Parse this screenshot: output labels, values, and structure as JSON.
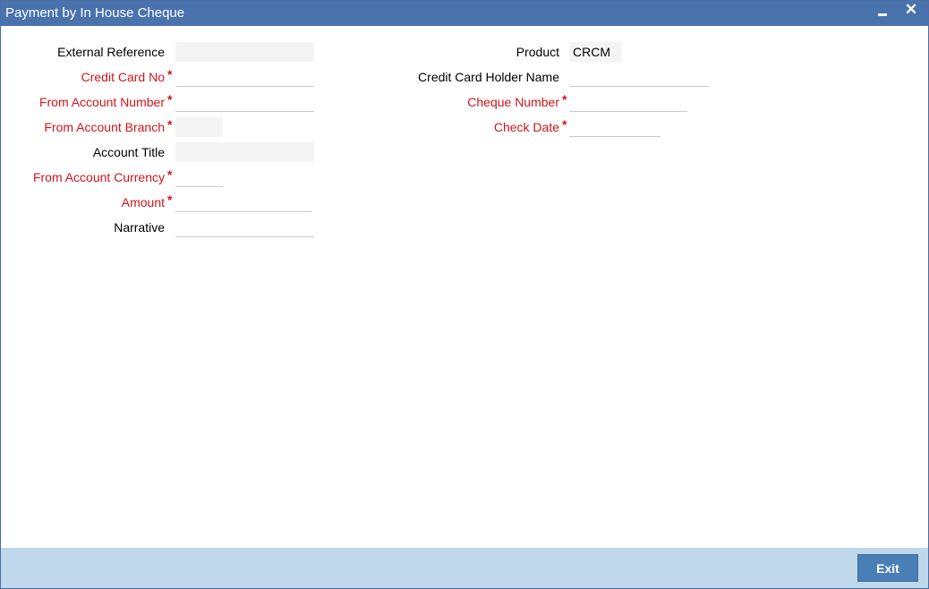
{
  "window": {
    "title": "Payment by In House Cheque",
    "minimize_glyph": "‒",
    "close_glyph": "✕"
  },
  "left_fields": {
    "external_reference": {
      "label": "External Reference",
      "value": ""
    },
    "credit_card_no": {
      "label": "Credit Card No",
      "value": "",
      "required": "*"
    },
    "from_account_number": {
      "label": "From Account Number",
      "value": "",
      "required": "*"
    },
    "from_account_branch": {
      "label": "From Account Branch",
      "value": "",
      "required": "*"
    },
    "account_title": {
      "label": "Account Title",
      "value": ""
    },
    "from_account_currency": {
      "label": "From Account Currency",
      "value": "",
      "required": "*"
    },
    "amount": {
      "label": "Amount",
      "value": "",
      "required": "*"
    },
    "narrative": {
      "label": "Narrative",
      "value": ""
    }
  },
  "right_fields": {
    "product": {
      "label": "Product",
      "value": "CRCM"
    },
    "credit_card_holder_name": {
      "label": "Credit Card Holder Name",
      "value": ""
    },
    "cheque_number": {
      "label": "Cheque Number",
      "value": "",
      "required": "*"
    },
    "check_date": {
      "label": "Check Date",
      "value": "",
      "required": "*"
    }
  },
  "footer": {
    "exit_label": "Exit"
  },
  "colors": {
    "titlebar": "#4a72ad",
    "required_label": "#d0141c",
    "footer": "#c0d8ec",
    "exit_button": "#4a7fb5"
  }
}
